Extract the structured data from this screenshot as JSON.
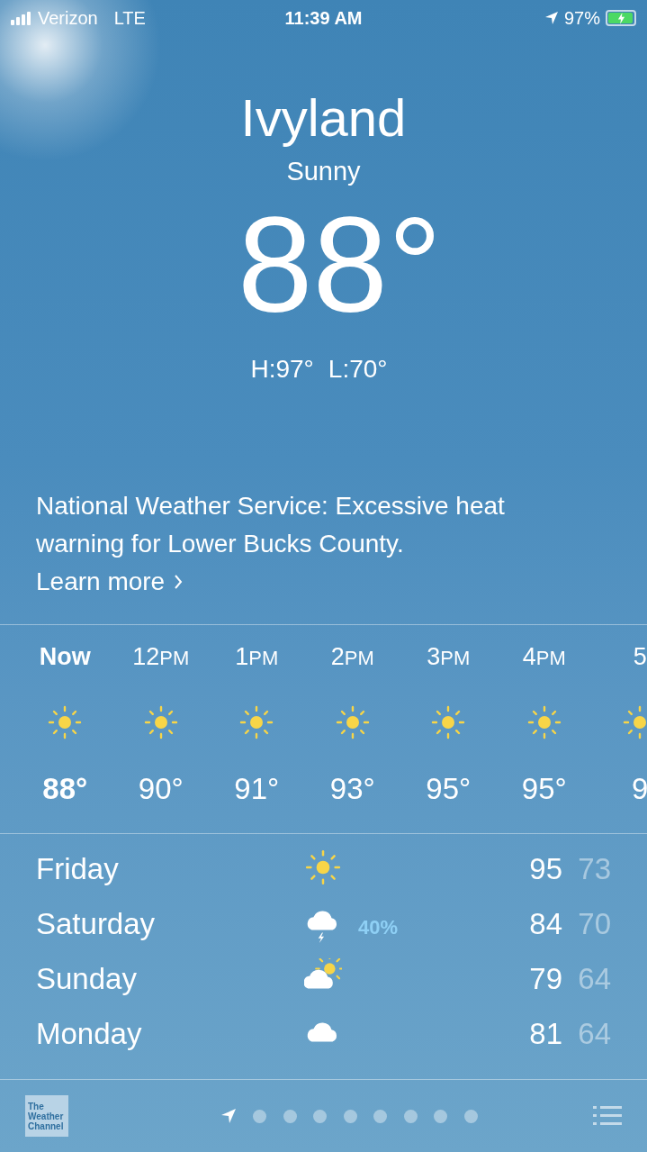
{
  "status_bar": {
    "carrier": "Verizon",
    "network": "LTE",
    "time": "11:39 AM",
    "battery": "97%",
    "charging": true
  },
  "header": {
    "city": "Ivyland",
    "condition": "Sunny",
    "temperature": "88°",
    "high": "H:97°",
    "low": "L:70°"
  },
  "alert": {
    "text": "National Weather Service: Excessive heat warning for Lower Bucks County.",
    "link": "Learn more"
  },
  "hourly": [
    {
      "hour": "Now",
      "kind": "sun",
      "temp": "88°",
      "selected": true
    },
    {
      "hour": "12",
      "suffix": "PM",
      "kind": "sun",
      "temp": "90°",
      "selected": false
    },
    {
      "hour": "1",
      "suffix": "PM",
      "kind": "sun",
      "temp": "91°",
      "selected": false
    },
    {
      "hour": "2",
      "suffix": "PM",
      "kind": "sun",
      "temp": "93°",
      "selected": false
    },
    {
      "hour": "3",
      "suffix": "PM",
      "kind": "sun",
      "temp": "95°",
      "selected": false
    },
    {
      "hour": "4",
      "suffix": "PM",
      "kind": "sun",
      "temp": "95°",
      "selected": false
    },
    {
      "hour": "5",
      "kind": "sun",
      "temp": "9",
      "selected": false
    }
  ],
  "daily": [
    {
      "day": "Friday",
      "kind": "sun",
      "high": "95",
      "low": "73"
    },
    {
      "day": "Saturday",
      "kind": "thunder",
      "precip": "40%",
      "high": "84",
      "low": "70"
    },
    {
      "day": "Sunday",
      "kind": "partly",
      "high": "79",
      "low": "64"
    },
    {
      "day": "Monday",
      "kind": "cloud",
      "high": "81",
      "low": "64"
    }
  ],
  "footer": {
    "logo": [
      "The",
      "Weather",
      "Channel"
    ],
    "pages": [
      {
        "kind": "location",
        "selected": true
      },
      {
        "kind": "dot",
        "selected": false
      },
      {
        "kind": "dot",
        "selected": false
      },
      {
        "kind": "dot",
        "selected": false
      },
      {
        "kind": "dot",
        "selected": false
      },
      {
        "kind": "dot",
        "selected": false
      },
      {
        "kind": "dot",
        "selected": false
      },
      {
        "kind": "dot",
        "selected": false
      },
      {
        "kind": "dot",
        "selected": false
      }
    ]
  }
}
